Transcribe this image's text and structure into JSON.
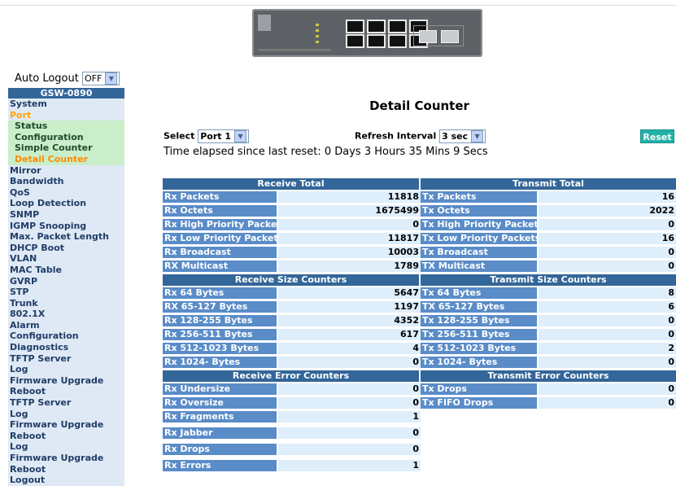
{
  "auto_logout": {
    "label": "Auto Logout",
    "value": "OFF"
  },
  "sidebar": {
    "title": "GSW-0890",
    "items": [
      {
        "label": "System",
        "type": "item"
      },
      {
        "label": "Port",
        "type": "item",
        "active": true
      },
      {
        "label": "Status",
        "type": "sub"
      },
      {
        "label": "Configuration",
        "type": "sub"
      },
      {
        "label": "Simple Counter",
        "type": "sub"
      },
      {
        "label": "Detail Counter",
        "type": "sub",
        "active": true
      },
      {
        "label": "Mirror",
        "type": "item"
      },
      {
        "label": "Bandwidth",
        "type": "item"
      },
      {
        "label": "QoS",
        "type": "item"
      },
      {
        "label": "Loop Detection",
        "type": "item"
      },
      {
        "label": "SNMP",
        "type": "item"
      },
      {
        "label": "IGMP Snooping",
        "type": "item"
      },
      {
        "label": "Max. Packet Length",
        "type": "item"
      },
      {
        "label": "DHCP Boot",
        "type": "item"
      },
      {
        "label": "VLAN",
        "type": "item"
      },
      {
        "label": "MAC Table",
        "type": "item"
      },
      {
        "label": "GVRP",
        "type": "item"
      },
      {
        "label": "STP",
        "type": "item"
      },
      {
        "label": "Trunk",
        "type": "item"
      },
      {
        "label": "802.1X",
        "type": "item"
      },
      {
        "label": "Alarm",
        "type": "item"
      },
      {
        "label": "Configuration",
        "type": "item"
      },
      {
        "label": "Diagnostics",
        "type": "item"
      },
      {
        "label": "TFTP Server",
        "type": "item"
      },
      {
        "label": "Log",
        "type": "item"
      },
      {
        "label": "Firmware Upgrade",
        "type": "item"
      },
      {
        "label": "Reboot",
        "type": "item"
      },
      {
        "label": "TFTP Server",
        "type": "item"
      },
      {
        "label": "Log",
        "type": "item"
      },
      {
        "label": "Firmware Upgrade",
        "type": "item"
      },
      {
        "label": "Reboot",
        "type": "item"
      },
      {
        "label": "Log",
        "type": "item"
      },
      {
        "label": "Firmware Upgrade",
        "type": "item"
      },
      {
        "label": "Reboot",
        "type": "item"
      },
      {
        "label": "Logout",
        "type": "item"
      }
    ]
  },
  "main": {
    "title": "Detail Counter",
    "select_label": "Select",
    "select_value": "Port 1",
    "refresh_label": "Refresh Interval",
    "refresh_value": "3 sec",
    "reset_label": "Reset",
    "elapsed": "Time elapsed since last reset: 0 Days 3 Hours 35 Mins 9 Secs"
  },
  "counters": {
    "sections": [
      {
        "rx_title": "Receive Total",
        "tx_title": "Transmit Total",
        "rx": [
          [
            "Rx Packets",
            "11818"
          ],
          [
            "Rx Octets",
            "1675499"
          ],
          [
            "Rx High Priority Packets",
            "0"
          ],
          [
            "Rx Low Priority Packets",
            "11817"
          ],
          [
            "Rx Broadcast",
            "10003"
          ],
          [
            "RX Multicast",
            "1789"
          ]
        ],
        "tx": [
          [
            "Tx Packets",
            "16"
          ],
          [
            "Tx Octets",
            "2022"
          ],
          [
            "Tx High Priority Packets",
            "0"
          ],
          [
            "Tx Low Priority Packets",
            "16"
          ],
          [
            "Tx Broadcast",
            "0"
          ],
          [
            "TX Multicast",
            "0"
          ]
        ]
      },
      {
        "rx_title": "Receive Size Counters",
        "tx_title": "Transmit Size Counters",
        "rx": [
          [
            "Rx 64 Bytes",
            "5647"
          ],
          [
            "RX 65-127 Bytes",
            "1197"
          ],
          [
            "Rx 128-255 Bytes",
            "4352"
          ],
          [
            "Rx 256-511 Bytes",
            "617"
          ],
          [
            "Rx 512-1023 Bytes",
            "4"
          ],
          [
            "Rx 1024- Bytes",
            "0"
          ]
        ],
        "tx": [
          [
            "Tx 64 Bytes",
            "8"
          ],
          [
            "TX 65-127 Bytes",
            "6"
          ],
          [
            "Tx 128-255 Bytes",
            "0"
          ],
          [
            "Tx 256-511 Bytes",
            "0"
          ],
          [
            "Tx 512-1023 Bytes",
            "2"
          ],
          [
            "Tx 1024- Bytes",
            "0"
          ]
        ]
      },
      {
        "rx_title": "Receive Error Counters",
        "tx_title": "Transmit Error Counters",
        "rx": [
          [
            "Rx Undersize",
            "0"
          ],
          [
            "Rx Oversize",
            "0"
          ],
          [
            "Rx Fragments",
            "1"
          ],
          [
            "Rx Jabber",
            "0"
          ],
          [
            "Rx Drops",
            "0"
          ],
          [
            "Rx Errors",
            "1"
          ]
        ],
        "tx": [
          [
            "Tx Drops",
            "0"
          ],
          [
            "Tx FIFO Drops",
            "0"
          ]
        ]
      }
    ]
  },
  "colors": {
    "header": "#336699",
    "label": "#5a8cc8",
    "value_bg": "#dfeefb",
    "reset": "#21b2a9",
    "active_menu": "#ffa500"
  }
}
